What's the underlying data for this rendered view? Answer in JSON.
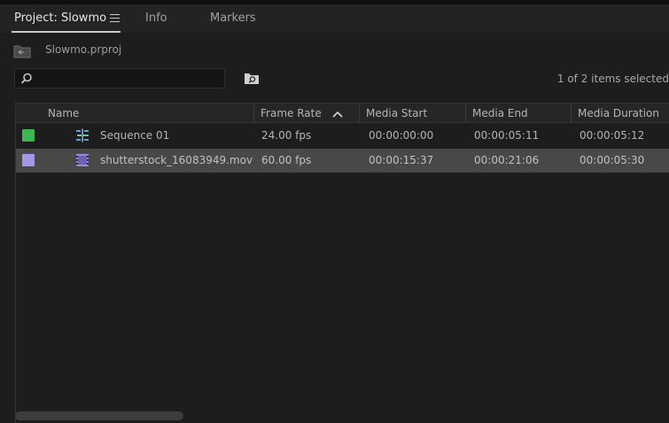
{
  "tabs": [
    {
      "label": "Project: Slowmo",
      "active": true
    },
    {
      "label": "Info",
      "active": false
    },
    {
      "label": "Markers",
      "active": false
    }
  ],
  "project": {
    "filename": "Slowmo.prproj"
  },
  "search": {
    "value": "",
    "items_count": "1 of 2 items selected"
  },
  "table": {
    "columns": {
      "name": "Name",
      "frame_rate": "Frame Rate",
      "media_start": "Media Start",
      "media_end": "Media End",
      "media_duration": "Media Duration"
    },
    "sort_column": "Frame Rate",
    "sort_direction": "ascending",
    "rows": [
      {
        "label_color": "#3fb553",
        "icon": "sequence-icon",
        "name": "Sequence 01",
        "frame_rate": "24.00 fps",
        "media_start": "00:00:00:00",
        "media_end": "00:00:05:11",
        "media_duration": "00:00:05:12",
        "selected": false
      },
      {
        "label_color": "#a696e6",
        "icon": "video-clip-icon",
        "name": "shutterstock_16083949.mov",
        "frame_rate": "60.00 fps",
        "media_start": "00:00:15:37",
        "media_end": "00:00:21:06",
        "media_duration": "00:00:05:30",
        "selected": true
      }
    ]
  }
}
